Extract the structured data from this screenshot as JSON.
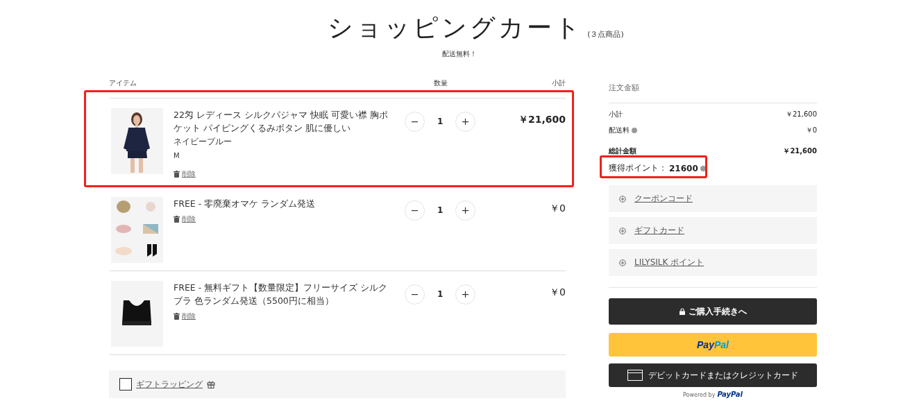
{
  "header": {
    "title": "ショッピングカート",
    "count": "(３点商品)",
    "notice": "配送無料！"
  },
  "columns": [
    "アイテム",
    "数量",
    "小計"
  ],
  "items": [
    {
      "name": "22匁 レディース シルクパジャマ 快眠 可愛い襟 胸ポケット パイピングくるみボタン 肌に優しい",
      "color_name": "ネイビーブルー",
      "size": "M",
      "remove": "削除",
      "quantity": "1",
      "price": "￥21,600",
      "kind": "pajamas",
      "highlighted": true
    },
    {
      "name": "FREE - 零廃棄オマケ ランダム発送",
      "remove": "削除",
      "quantity": "1",
      "price": "￥0",
      "kind": "assortment",
      "highlighted": false
    },
    {
      "name": "FREE - 無料ギフト【数量限定】フリーサイズ シルクブラ 色ランダム発送（5500円に相当）",
      "remove": "削除",
      "quantity": "1",
      "price": "￥0",
      "kind": "bra",
      "highlighted": false
    }
  ],
  "gift_wrapping": {
    "label": "ギフトラッピング",
    "checked": false
  },
  "summary": {
    "title": "注文金額",
    "lines": [
      {
        "label": "小計",
        "value": "￥21,600",
        "info": false,
        "bold": false
      },
      {
        "label": "配送料",
        "value": "￥0",
        "info": true,
        "bold": false
      },
      {
        "label": "総計金額",
        "value": "￥21,600",
        "info": false,
        "bold": true
      }
    ],
    "points": {
      "label": "獲得ポイント：",
      "value": "21600",
      "highlighted": true
    },
    "expanders": [
      "クーポンコード",
      "ギフトカード",
      "LILYSILK ポイント"
    ],
    "checkout": "ご購入手続きへ",
    "paypal": [
      "Pay",
      "Pal"
    ],
    "card": "デビットカードまたはクレジットカード",
    "powered": [
      "Powered by",
      "PayPal"
    ]
  }
}
